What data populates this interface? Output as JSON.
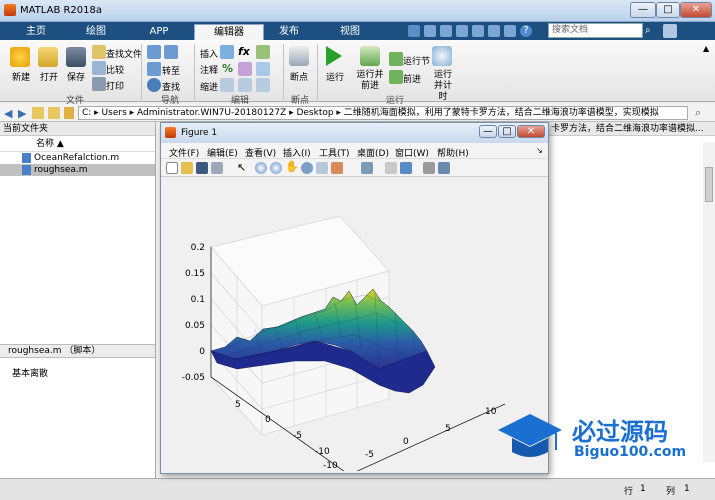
{
  "app": {
    "title": "MATLAB R2018a",
    "minimize": "—",
    "maximize": "□",
    "close": "✕"
  },
  "tabs": [
    "主页",
    "绘图",
    "APP",
    "编辑器",
    "发布",
    "视图"
  ],
  "search": {
    "placeholder": "搜索文档"
  },
  "ribbon": {
    "new": "新建",
    "open": "打开",
    "save": "保存",
    "find_files": "查找文件",
    "compare": "比较",
    "print": "打印",
    "goto": "转至",
    "find": "查找",
    "insert": "插入",
    "comment": "注释",
    "indent": "缩进",
    "breakpoint": "断点",
    "run": "运行",
    "run_advance": "运行并前进",
    "run_section": "运行节",
    "advance": "前进",
    "run_time": "运行并计时",
    "groups": {
      "file": "文件",
      "navigate": "导航",
      "edit": "编辑",
      "breakpoints": "断点",
      "run": "运行"
    }
  },
  "address": {
    "path": "C: ▸ Users ▸ Administrator.WIN7U-20180127Z ▸ Desktop ▸ 二维随机海面模拟，利用了蒙特卡罗方法，结合二维海浪功率谱模型，实现模拟"
  },
  "left": {
    "header": "当前文件夹",
    "col_name": "名称 ▲",
    "files": [
      "OceanRefalction.m",
      "roughsea.m"
    ],
    "detail_title": "roughsea.m （脚本）",
    "detail_body": "基本离散"
  },
  "editor": {
    "tab_text": "卡罗方法，结合二维海浪功率谱模拟..."
  },
  "status": {
    "row_label": "行",
    "row": "1",
    "col_label": "列",
    "col": "1"
  },
  "figure": {
    "title": "Figure 1",
    "menu": [
      "文件(F)",
      "编辑(E)",
      "查看(V)",
      "插入(I)",
      "工具(T)",
      "桌面(D)",
      "窗口(W)",
      "帮助(H)"
    ],
    "z_ticks": [
      "0.2",
      "0.15",
      "0.1",
      "0.05",
      "0",
      "-0.05"
    ],
    "x_ticks": [
      "5",
      "0",
      "-5",
      "-10"
    ],
    "y_ticks": [
      "10",
      "5",
      "0",
      "-5",
      "-10"
    ]
  },
  "logo": {
    "cn": "必过源码",
    "url": "Biguo100.com"
  },
  "colors": {
    "tabbar": "#1d4f80",
    "surface_low": "#2a2a8a",
    "surface_mid": "#1e9a8a",
    "surface_high": "#e8d020"
  }
}
